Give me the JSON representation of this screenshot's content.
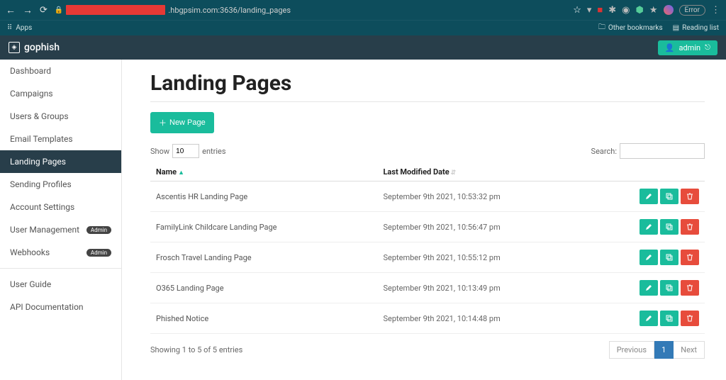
{
  "browser": {
    "url_host": ".hbgpsim.com:3636/landing_pages",
    "apps_label": "Apps",
    "other_bookmarks": "Other bookmarks",
    "reading_list": "Reading list",
    "error_label": "Error"
  },
  "header": {
    "brand": "gophish",
    "user": "admin"
  },
  "sidebar": {
    "items": [
      {
        "label": "Dashboard",
        "active": false,
        "badge": null
      },
      {
        "label": "Campaigns",
        "active": false,
        "badge": null
      },
      {
        "label": "Users & Groups",
        "active": false,
        "badge": null
      },
      {
        "label": "Email Templates",
        "active": false,
        "badge": null
      },
      {
        "label": "Landing Pages",
        "active": true,
        "badge": null
      },
      {
        "label": "Sending Profiles",
        "active": false,
        "badge": null
      },
      {
        "label": "Account Settings",
        "active": false,
        "badge": null
      },
      {
        "label": "User Management",
        "active": false,
        "badge": "Admin"
      },
      {
        "label": "Webhooks",
        "active": false,
        "badge": "Admin"
      }
    ],
    "docs": [
      {
        "label": "User Guide"
      },
      {
        "label": "API Documentation"
      }
    ]
  },
  "page": {
    "title": "Landing Pages",
    "new_button": "New Page",
    "show_label": "Show",
    "entries_value": "10",
    "entries_label": "entries",
    "search_label": "Search:",
    "table": {
      "columns": [
        "Name",
        "Last Modified Date"
      ],
      "rows": [
        {
          "name": "Ascentis HR Landing Page",
          "modified": "September 9th 2021, 10:53:32 pm"
        },
        {
          "name": "FamilyLink Childcare Landing Page",
          "modified": "September 9th 2021, 10:56:47 pm"
        },
        {
          "name": "Frosch Travel Landing Page",
          "modified": "September 9th 2021, 10:55:12 pm"
        },
        {
          "name": "O365 Landing Page",
          "modified": "September 9th 2021, 10:13:49 pm"
        },
        {
          "name": "Phished Notice",
          "modified": "September 9th 2021, 10:14:48 pm"
        }
      ]
    },
    "footer_info": "Showing 1 to 5 of 5 entries",
    "pager": {
      "prev": "Previous",
      "current": "1",
      "next": "Next"
    }
  }
}
